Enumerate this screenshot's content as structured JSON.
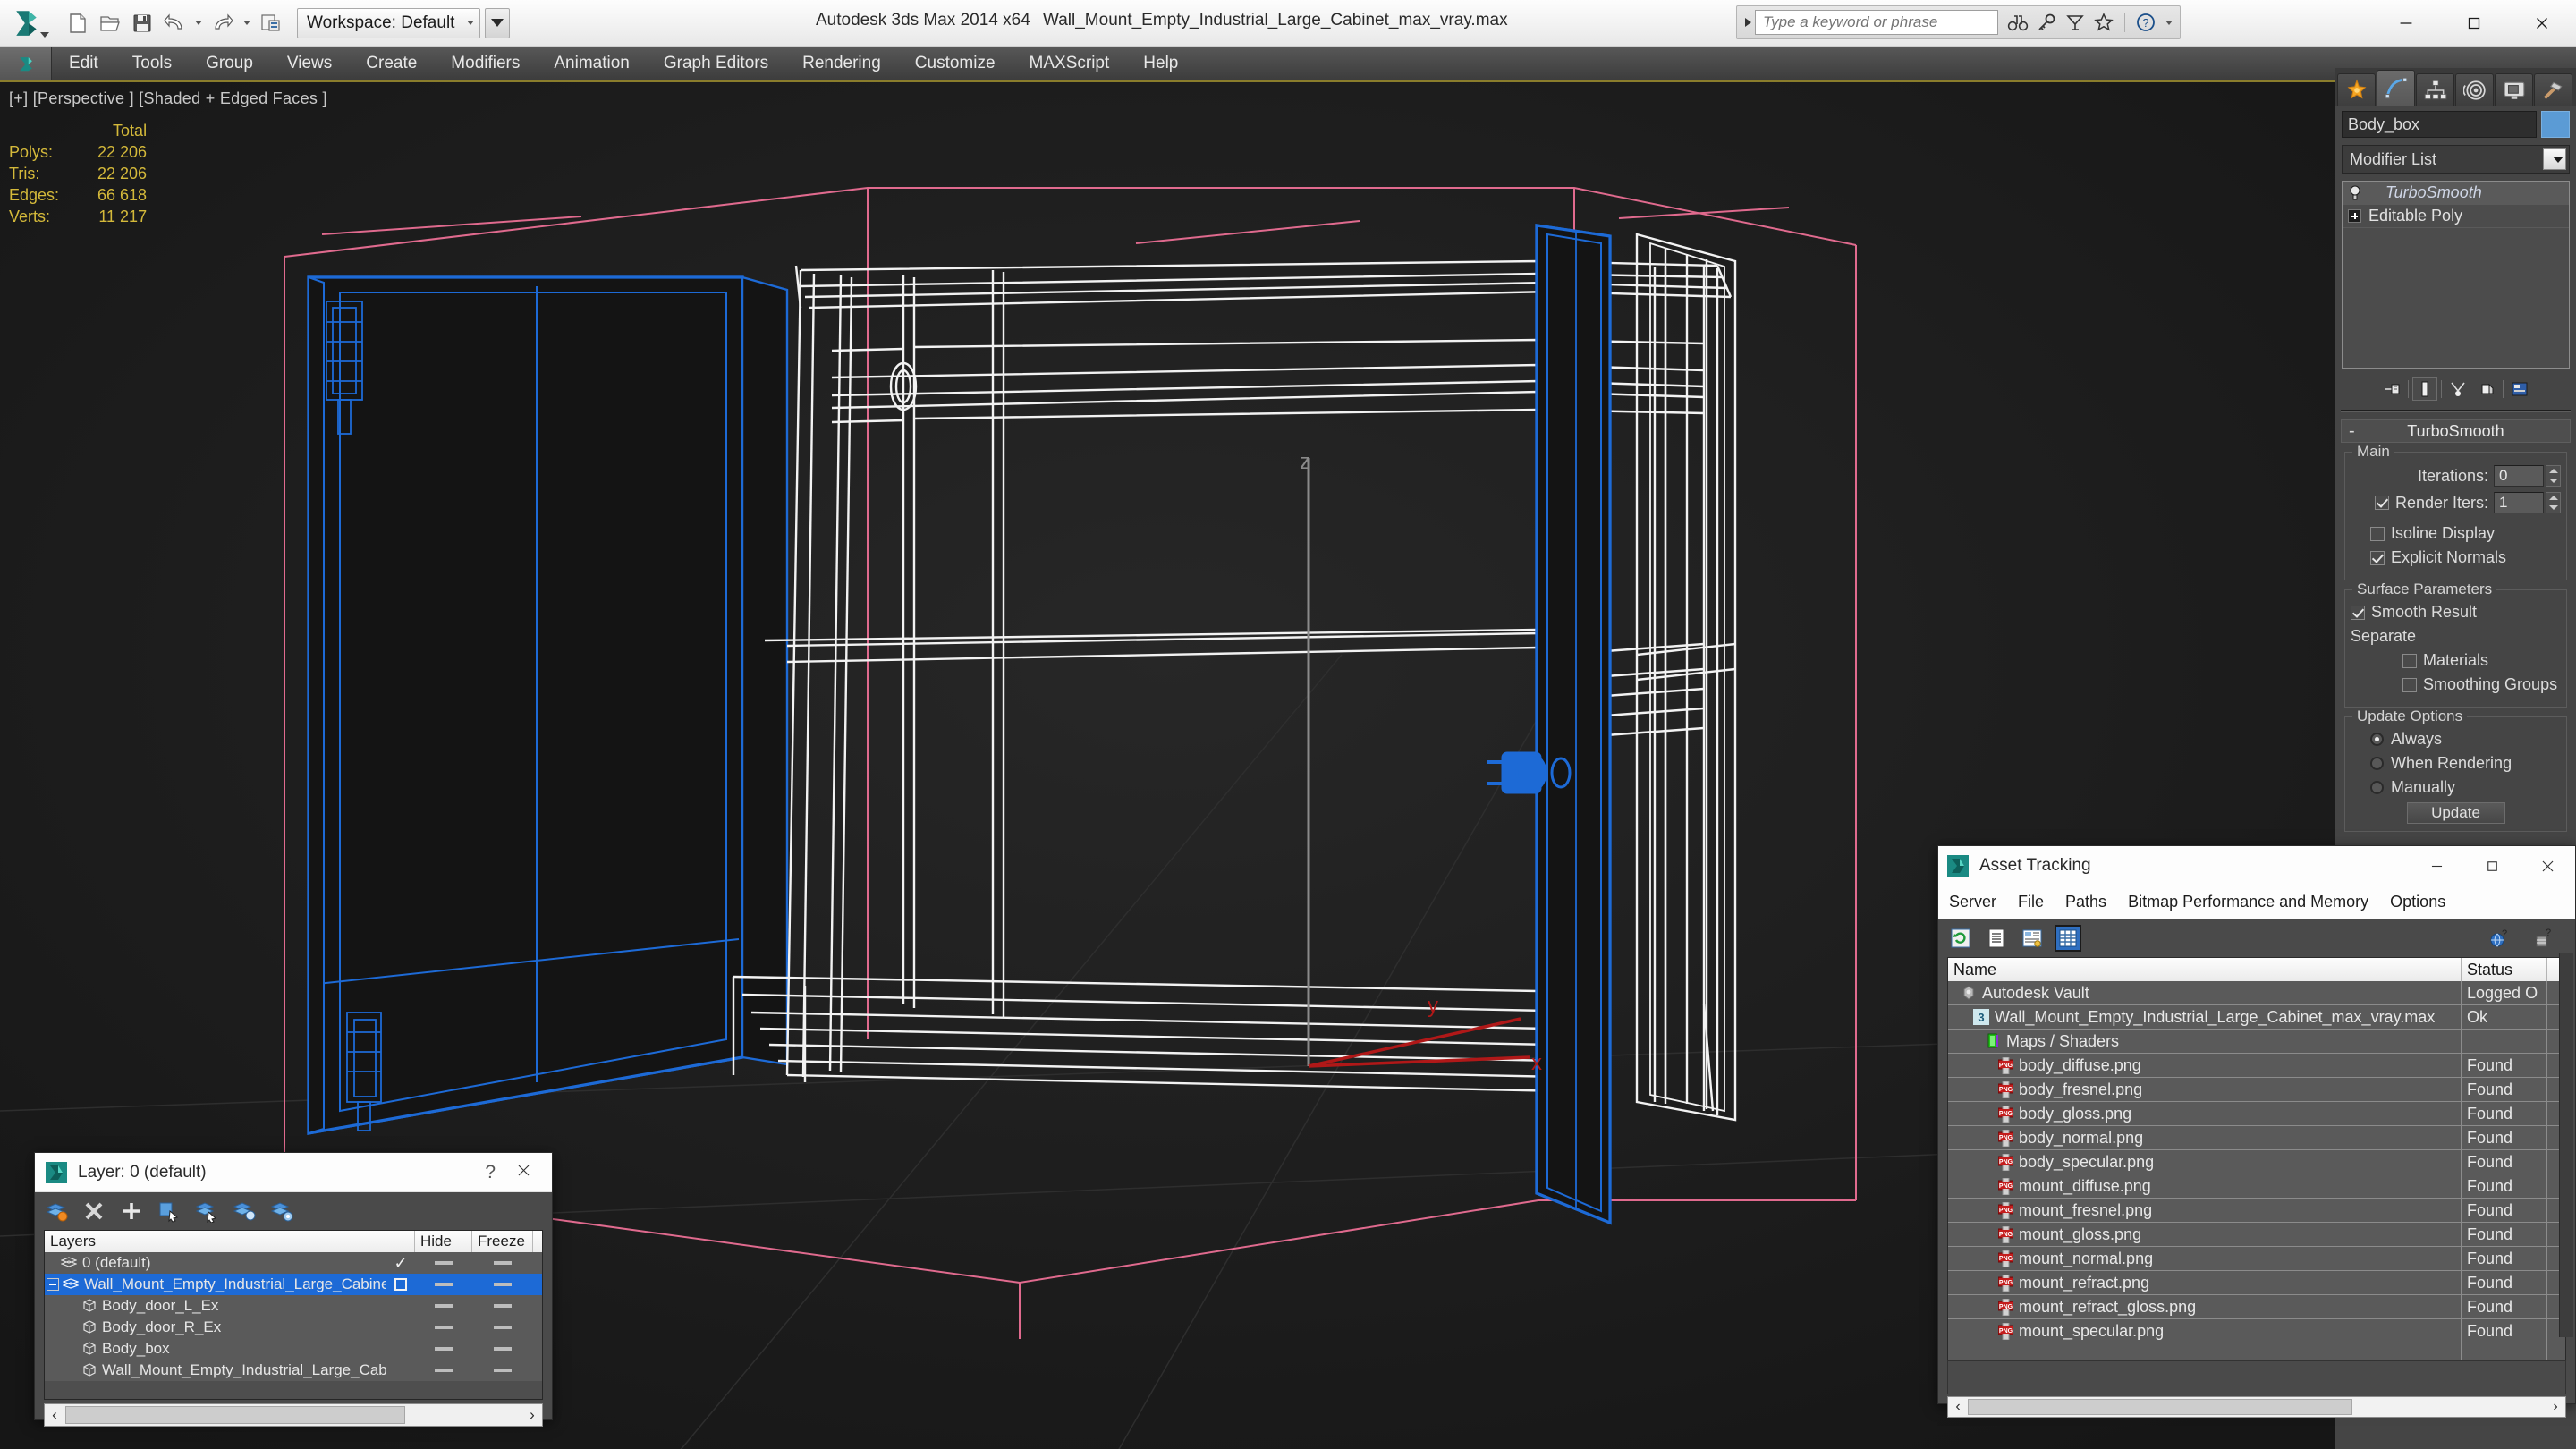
{
  "titlebar": {
    "app_title": "Autodesk 3ds Max  2014 x64",
    "file_title": "Wall_Mount_Empty_Industrial_Large_Cabinet_max_vray.max",
    "workspace_label": "Workspace: Default",
    "quick_access": [
      {
        "name": "new-file-icon",
        "label": "New"
      },
      {
        "name": "open-file-icon",
        "label": "Open"
      },
      {
        "name": "save-file-icon",
        "label": "Save"
      },
      {
        "name": "undo-icon",
        "label": "Undo"
      },
      {
        "name": "redo-icon",
        "label": "Redo"
      },
      {
        "name": "project-folder-icon",
        "label": "Set Project Folder"
      }
    ],
    "search_placeholder": "Type a keyword or phrase",
    "search_value": "",
    "help_icons": [
      "binoculars-icon",
      "key-icon",
      "satellite-icon",
      "star-icon",
      "question-icon"
    ],
    "window_controls": [
      "minimize",
      "maximize",
      "close"
    ]
  },
  "menubar": {
    "items": [
      "Edit",
      "Tools",
      "Group",
      "Views",
      "Create",
      "Modifiers",
      "Animation",
      "Graph Editors",
      "Rendering",
      "Customize",
      "MAXScript",
      "Help"
    ]
  },
  "viewport": {
    "label": "[+] [Perspective ] [Shaded + Edged Faces ]",
    "stats": {
      "header": "Total",
      "rows": [
        {
          "label": "Polys:",
          "value": "22 206"
        },
        {
          "label": "Tris:",
          "value": "22 206"
        },
        {
          "label": "Edges:",
          "value": "66 618"
        },
        {
          "label": "Verts:",
          "value": "11 217"
        }
      ]
    },
    "axis_labels": {
      "x": "x",
      "y": "y",
      "z": "z"
    },
    "colors": {
      "background": "#1c1c1c",
      "wireframe": "#ffffff",
      "selected": "#1d6ad6",
      "helper": "#e06a8e",
      "axis_x": "#b01818",
      "axis_y": "#b01818",
      "axis_z": "#8a8a8a",
      "stats_text": "#d4b93a"
    }
  },
  "command_panel": {
    "tabs": [
      {
        "name": "create-tab",
        "icon": "star-burst-icon",
        "active": false
      },
      {
        "name": "modify-tab",
        "icon": "curve-icon",
        "active": true
      },
      {
        "name": "hierarchy-tab",
        "icon": "hierarchy-icon",
        "active": false
      },
      {
        "name": "motion-tab",
        "icon": "motion-wheel-icon",
        "active": false
      },
      {
        "name": "display-tab",
        "icon": "display-monitor-icon",
        "active": false
      },
      {
        "name": "utilities-tab",
        "icon": "hammer-icon",
        "active": false
      }
    ],
    "object_name": "Body_box",
    "object_color": "#5b9bd5",
    "modifier_list_label": "Modifier List",
    "modifier_stack": [
      {
        "name": "TurboSmooth",
        "selected": true,
        "italic": true
      },
      {
        "name": "Editable Poly",
        "selected": false,
        "italic": false
      }
    ],
    "stack_tools": [
      "pin-stack-icon",
      "show-end-result-icon",
      "make-unique-icon",
      "remove-modifier-icon",
      "configure-sets-icon"
    ],
    "rollout": {
      "title": "TurboSmooth",
      "collapse_glyph": "-",
      "main_group": {
        "title": "Main",
        "iterations_label": "Iterations:",
        "iterations_value": "0",
        "render_iters_label": "Render Iters:",
        "render_iters_value": "1",
        "render_iters_checked": true,
        "isoline_display_label": "Isoline Display",
        "isoline_display_checked": false,
        "explicit_normals_label": "Explicit Normals",
        "explicit_normals_checked": true
      },
      "surface_group": {
        "title": "Surface Parameters",
        "smooth_result_label": "Smooth Result",
        "smooth_result_checked": true,
        "separate_label": "Separate",
        "materials_label": "Materials",
        "materials_checked": false,
        "smoothing_groups_label": "Smoothing Groups",
        "smoothing_groups_checked": false
      },
      "update_group": {
        "title": "Update Options",
        "options": [
          {
            "label": "Always",
            "selected": true
          },
          {
            "label": "When Rendering",
            "selected": false
          },
          {
            "label": "Manually",
            "selected": false
          }
        ],
        "update_button": "Update"
      }
    }
  },
  "layer_dialog": {
    "title": "Layer: 0 (default)",
    "help_glyph": "?",
    "toolbar": [
      "new-layer-icon",
      "delete-layer-icon",
      "add-layer-icon",
      "select-objects-icon",
      "select-highlighted-icon",
      "highlight-selected-icon",
      "layer-properties-icon"
    ],
    "columns": [
      "Layers",
      "",
      "Hide",
      "Freeze"
    ],
    "rows": [
      {
        "name": "0 (default)",
        "indent": 0,
        "icon": "layer-icon",
        "selected": false,
        "checked": true,
        "box": false,
        "hide": "dash",
        "freeze": "dash",
        "expander": false
      },
      {
        "name": "Wall_Mount_Empty_Industrial_Large_Cabinet",
        "indent": 0,
        "icon": "layer-icon",
        "selected": true,
        "checked": false,
        "box": true,
        "hide": "dash",
        "freeze": "dash",
        "expander": true
      },
      {
        "name": "Body_door_L_Ex",
        "indent": 1,
        "icon": "object-icon",
        "selected": false,
        "checked": false,
        "box": false,
        "hide": "dash",
        "freeze": "dash",
        "expander": false
      },
      {
        "name": "Body_door_R_Ex",
        "indent": 1,
        "icon": "object-icon",
        "selected": false,
        "checked": false,
        "box": false,
        "hide": "dash",
        "freeze": "dash",
        "expander": false
      },
      {
        "name": "Body_box",
        "indent": 1,
        "icon": "object-icon",
        "selected": false,
        "checked": false,
        "box": false,
        "hide": "dash",
        "freeze": "dash",
        "expander": false
      },
      {
        "name": "Wall_Mount_Empty_Industrial_Large_Cabinet",
        "indent": 1,
        "icon": "object-icon",
        "selected": false,
        "checked": false,
        "box": false,
        "hide": "dash",
        "freeze": "dash",
        "expander": false
      }
    ],
    "scroll_left": "‹",
    "scroll_right": "›"
  },
  "asset_tracking": {
    "title": "Asset Tracking",
    "menu": [
      "Server",
      "File",
      "Paths",
      "Bitmap Performance and Memory",
      "Options"
    ],
    "toolbar": [
      "refresh-icon",
      "list-view-icon",
      "detail-view-icon",
      "grid-view-icon"
    ],
    "toolbar_right": [
      "help-globe-icon",
      "help-tree-icon"
    ],
    "columns": [
      "Name",
      "Status"
    ],
    "rows": [
      {
        "name": "Autodesk Vault",
        "status": "Logged O",
        "indent": 0,
        "icon": "vault-icon"
      },
      {
        "name": "Wall_Mount_Empty_Industrial_Large_Cabinet_max_vray.max",
        "status": "Ok",
        "indent": 1,
        "icon": "max-file-icon"
      },
      {
        "name": "Maps / Shaders",
        "status": "",
        "indent": 2,
        "icon": "maps-shaders-icon"
      },
      {
        "name": "body_diffuse.png",
        "status": "Found",
        "indent": 3,
        "icon": "png-icon"
      },
      {
        "name": "body_fresnel.png",
        "status": "Found",
        "indent": 3,
        "icon": "png-icon"
      },
      {
        "name": "body_gloss.png",
        "status": "Found",
        "indent": 3,
        "icon": "png-icon"
      },
      {
        "name": "body_normal.png",
        "status": "Found",
        "indent": 3,
        "icon": "png-icon"
      },
      {
        "name": "body_specular.png",
        "status": "Found",
        "indent": 3,
        "icon": "png-icon"
      },
      {
        "name": "mount_diffuse.png",
        "status": "Found",
        "indent": 3,
        "icon": "png-icon"
      },
      {
        "name": "mount_fresnel.png",
        "status": "Found",
        "indent": 3,
        "icon": "png-icon"
      },
      {
        "name": "mount_gloss.png",
        "status": "Found",
        "indent": 3,
        "icon": "png-icon"
      },
      {
        "name": "mount_normal.png",
        "status": "Found",
        "indent": 3,
        "icon": "png-icon"
      },
      {
        "name": "mount_refract.png",
        "status": "Found",
        "indent": 3,
        "icon": "png-icon"
      },
      {
        "name": "mount_refract_gloss.png",
        "status": "Found",
        "indent": 3,
        "icon": "png-icon"
      },
      {
        "name": "mount_specular.png",
        "status": "Found",
        "indent": 3,
        "icon": "png-icon"
      },
      {
        "name": "",
        "status": "",
        "indent": 0,
        "icon": "none"
      },
      {
        "name": "",
        "status": "",
        "indent": 0,
        "icon": "none"
      }
    ],
    "scroll_left": "‹",
    "scroll_right": "›"
  }
}
